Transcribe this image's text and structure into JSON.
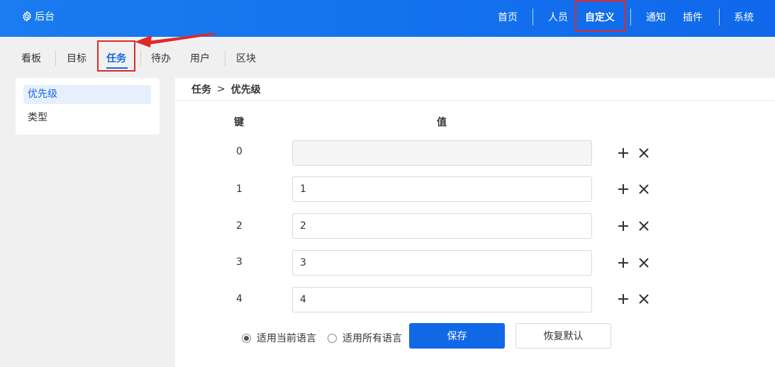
{
  "header": {
    "brand": "后台",
    "nav": [
      {
        "label": "首页"
      },
      {
        "label": "人员"
      },
      {
        "label": "自定义"
      },
      {
        "label": "通知"
      },
      {
        "label": "插件"
      },
      {
        "label": "系统"
      }
    ],
    "active_nav": "自定义"
  },
  "subnav": {
    "items": [
      {
        "label": "看板"
      },
      {
        "label": "目标"
      },
      {
        "label": "任务"
      },
      {
        "label": "待办"
      },
      {
        "label": "用户"
      },
      {
        "label": "区块"
      }
    ],
    "active": "任务"
  },
  "sidebar": {
    "items": [
      {
        "label": "优先级"
      },
      {
        "label": "类型"
      }
    ],
    "active": "优先级"
  },
  "breadcrumb": {
    "parent": "任务",
    "separator": ">",
    "current": "优先级"
  },
  "table": {
    "key_header": "键",
    "value_header": "值",
    "rows": [
      {
        "key": "0",
        "value": ""
      },
      {
        "key": "1",
        "value": "1"
      },
      {
        "key": "2",
        "value": "2"
      },
      {
        "key": "3",
        "value": "3"
      },
      {
        "key": "4",
        "value": "4"
      }
    ]
  },
  "lang_options": {
    "current": "适用当前语言",
    "all": "适用所有语言",
    "selected": "current"
  },
  "buttons": {
    "save": "保存",
    "reset": "恢复默认"
  },
  "colors": {
    "header_bg": "#1a7cf0",
    "accent": "#1866e0",
    "highlight": "#e02828",
    "primary_button": "#1068e6"
  }
}
